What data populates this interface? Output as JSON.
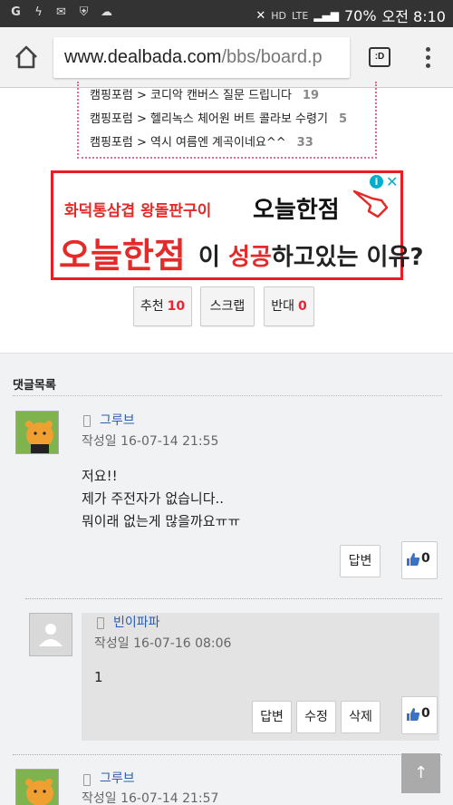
{
  "status_bar": {
    "left_icons": [
      "g-icon",
      "flash-icon",
      "mail-icon",
      "shield-icon",
      "cloud-icon"
    ],
    "signal_labels": [
      "HD",
      "LTE"
    ],
    "battery": "70%",
    "time": "오전 8:10"
  },
  "browser": {
    "url_host": "www.dealbada.com",
    "url_path": "/bbs/board.p",
    "tabs_label": ":D"
  },
  "related": {
    "items": [
      {
        "text": "캠핑포럼 > 코디악 캔버스 질문 드립니다",
        "count": "19"
      },
      {
        "text": "캠핑포럼 > 헬리녹스 체어원 버트 콜라보 수령기",
        "count": "5"
      },
      {
        "text": "캠핑포럼 > 역시 여름엔 계곡이네요^^",
        "count": "33"
      }
    ]
  },
  "ad": {
    "line1": "화덕통삼겹 왕돌판구이",
    "brand": "오늘한점",
    "headline_red": "오늘한점",
    "headline_rest_1": "이 ",
    "headline_bold": "성공",
    "headline_rest_2": "하고있는 이유?"
  },
  "vote": {
    "recommend_label": "추천",
    "recommend_count": "10",
    "scrap_label": "스크랩",
    "oppose_label": "반대",
    "oppose_count": "0"
  },
  "comments": {
    "title": "댓글목록",
    "items": [
      {
        "author": "그루브",
        "date": "작성일   16-07-14 21:55",
        "lines": [
          "저요!!",
          "제가 주전자가 없습니다..",
          "뭐이래 없는게 많을까요ㅠㅠ"
        ],
        "reply_label": "답변",
        "likes": "0"
      },
      {
        "author": "빈이파파",
        "date": "작성일   16-07-16 08:06",
        "lines": [
          "1"
        ],
        "reply_label": "답변",
        "edit_label": "수정",
        "delete_label": "삭제",
        "likes": "0"
      },
      {
        "author": "그루브",
        "date": "작성일   16-07-14 21:57"
      }
    ]
  },
  "to_top": "↑"
}
